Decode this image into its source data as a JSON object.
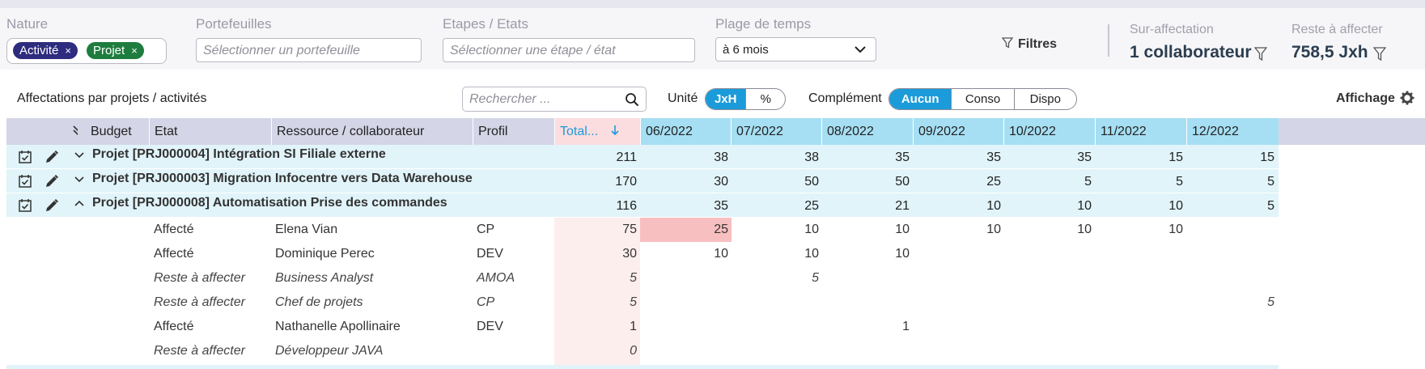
{
  "filters": {
    "nature": {
      "label": "Nature",
      "chips": [
        {
          "text": "Activité",
          "color": "#2e2c7e"
        },
        {
          "text": "Projet",
          "color": "#1e7d3e"
        }
      ],
      "remove_glyph": "×"
    },
    "portefeuilles": {
      "label": "Portefeuilles",
      "placeholder": "Sélectionner un portefeuille"
    },
    "etapes": {
      "label": "Etapes / Etats",
      "placeholder": "Sélectionner une étape / état"
    },
    "plage": {
      "label": "Plage de temps",
      "value": "à 6 mois"
    },
    "filters_button": "Filtres",
    "sur_affectation": {
      "label": "Sur-affectation",
      "value": "1 collaborateur"
    },
    "reste": {
      "label": "Reste à affecter",
      "value": "758,5 Jxh"
    }
  },
  "toolbar": {
    "title": "Affectations par projets / activités",
    "search_placeholder": "Rechercher ...",
    "unite_label": "Unité",
    "unite_options": [
      "JxH",
      "%"
    ],
    "unite_selected": "JxH",
    "complement_label": "Complément",
    "complement_options": [
      "Aucun",
      "Conso",
      "Dispo"
    ],
    "complement_selected": "Aucun",
    "affichage_label": "Affichage"
  },
  "table": {
    "headers": {
      "budget": "Budget",
      "etat": "Etat",
      "ressource": "Ressource / collaborateur",
      "profil": "Profil",
      "total": "Total...",
      "months": [
        "06/2022",
        "07/2022",
        "08/2022",
        "09/2022",
        "10/2022",
        "11/2022",
        "12/2022"
      ]
    },
    "projects": [
      {
        "name": "Projet [PRJ000004] Intégration SI Filiale externe",
        "expanded": false,
        "total": "211",
        "months": [
          "38",
          "38",
          "35",
          "35",
          "35",
          "15",
          "15"
        ]
      },
      {
        "name": "Projet [PRJ000003] Migration Infocentre vers Data Warehouse",
        "expanded": false,
        "total": "170",
        "months": [
          "30",
          "50",
          "50",
          "25",
          "5",
          "5",
          "5"
        ]
      },
      {
        "name": "Projet [PRJ000008] Automatisation Prise des commandes",
        "expanded": true,
        "total": "116",
        "months": [
          "35",
          "25",
          "21",
          "10",
          "10",
          "10",
          "5"
        ]
      }
    ],
    "details": [
      {
        "etat": "Affecté",
        "ressource": "Elena Vian",
        "profil": "CP",
        "total": "75",
        "months": [
          "25",
          "10",
          "10",
          "10",
          "10",
          "10",
          ""
        ],
        "italic": false,
        "overbooked_month": 0
      },
      {
        "etat": "Affecté",
        "ressource": "Dominique Perec",
        "profil": "DEV",
        "total": "30",
        "months": [
          "10",
          "10",
          "10",
          "",
          "",
          "",
          ""
        ],
        "italic": false
      },
      {
        "etat": "Reste à affecter",
        "ressource": "Business Analyst",
        "profil": "AMOA",
        "total": "5",
        "months": [
          "",
          "5",
          "",
          "",
          "",
          "",
          ""
        ],
        "italic": true
      },
      {
        "etat": "Reste à affecter",
        "ressource": "Chef de projets",
        "profil": "CP",
        "total": "5",
        "months": [
          "",
          "",
          "",
          "",
          "",
          "",
          "5"
        ],
        "italic": true
      },
      {
        "etat": "Affecté",
        "ressource": "Nathanelle Apollinaire",
        "profil": "DEV",
        "total": "1",
        "months": [
          "",
          "",
          "1",
          "",
          "",
          "",
          ""
        ],
        "italic": false
      },
      {
        "etat": "Reste à affecter",
        "ressource": "Développeur JAVA",
        "profil": "",
        "total": "0",
        "months": [
          "",
          "",
          "",
          "",
          "",
          "",
          ""
        ],
        "italic": true
      }
    ],
    "colors": {
      "project_row": "#e1f4fa",
      "month_header": "#a6dff3",
      "total_column": "#fdeeee",
      "overbooked": "#f8bfc0",
      "accent": "#1b9bd9"
    }
  }
}
